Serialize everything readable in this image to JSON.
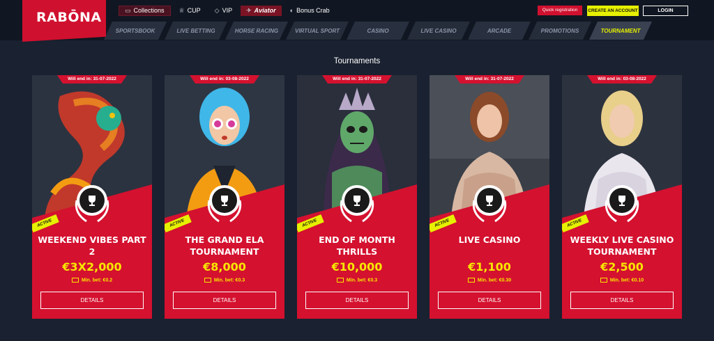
{
  "brand": {
    "logo_text": "RABŌNA"
  },
  "toplinks": [
    {
      "icon": "book-icon",
      "glyph": "▭",
      "label": "Collections"
    },
    {
      "icon": "cup-icon",
      "glyph": "♕",
      "label": "CUP"
    },
    {
      "icon": "diamond-icon",
      "glyph": "◇",
      "label": "VIP"
    },
    {
      "icon": "plane-icon",
      "glyph": "✈",
      "label": "Aviator"
    },
    {
      "icon": "crab-icon",
      "glyph": "◐",
      "label": "Bonus Crab"
    }
  ],
  "header_actions": {
    "quick_registration": "Quick registration",
    "create_account": "CREATE AN ACCOUNT",
    "login": "LOGIN"
  },
  "nav": [
    "SPORTSBOOK",
    "LIVE BETTING",
    "HORSE RACING",
    "VIRTUAL SPORT",
    "CASINO",
    "LIVE CASINO",
    "ARCADE",
    "PROMOTIONS",
    "TOURNAMENT"
  ],
  "nav_active": "TOURNAMENT",
  "section_title": "Tournaments",
  "cards": [
    {
      "ribbon": "Will end in: 31-07-2022",
      "badge": "ACTIVE",
      "title": "WEEKEND VIBES PART 2",
      "prize": "€3X2,000",
      "min_bet": "Min. bet: €0.2",
      "button": "DETAILS",
      "art": "dragon"
    },
    {
      "ribbon": "Will end in: 03-08-2022",
      "badge": "ACTIVE",
      "title": "THE GRAND ELA TOURNAMENT",
      "prize": "€8,000",
      "min_bet": "Min. bet: €0.3",
      "button": "DETAILS",
      "art": "girl"
    },
    {
      "ribbon": "Will end in: 31-07-2022",
      "badge": "ACTIVE",
      "title": "END OF MONTH THRILLS",
      "prize": "€10,000",
      "min_bet": "Min. bet: €0.3",
      "button": "DETAILS",
      "art": "skull"
    },
    {
      "ribbon": "Will end in: 31-07-2022",
      "badge": "ACTIVE",
      "title": "LIVE CASINO",
      "prize": "€1,100",
      "min_bet": "Min. bet: €0.30",
      "button": "DETAILS",
      "art": "dealer1"
    },
    {
      "ribbon": "Will end in: 03-08-2022",
      "badge": "ACTIVE",
      "title": "WEEKLY LIVE CASINO TOURNAMENT",
      "prize": "€2,500",
      "min_bet": "Min. bet: €0.10",
      "button": "DETAILS",
      "art": "dealer2"
    }
  ],
  "colors": {
    "brand_red": "#d4112f",
    "accent_yellow": "#e6f000",
    "prize_yellow": "#f7e600",
    "background": "#1a2130"
  }
}
